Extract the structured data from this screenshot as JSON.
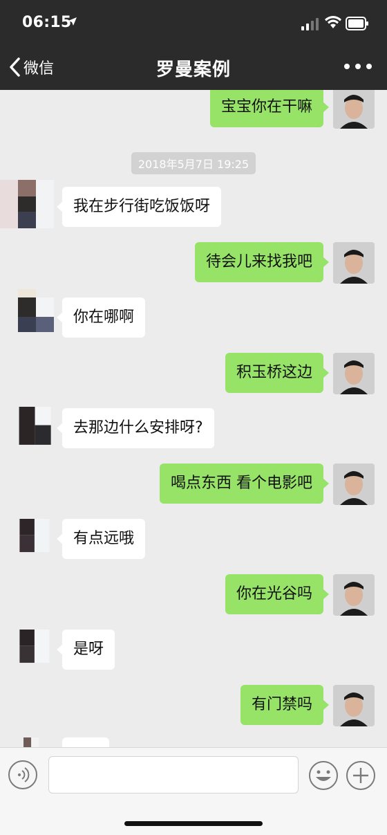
{
  "status_bar": {
    "time": "06:15"
  },
  "nav": {
    "back_label": "微信",
    "title": "罗曼案例"
  },
  "chat": {
    "timestamp": "2018年5月7日 19:25",
    "messages": [
      {
        "side": "out",
        "text": "宝宝你在干嘛"
      },
      {
        "side": "in",
        "text": "我在步行街吃饭饭呀"
      },
      {
        "side": "out",
        "text": "待会儿来找我吧"
      },
      {
        "side": "in",
        "text": "你在哪啊"
      },
      {
        "side": "out",
        "text": "积玉桥这边"
      },
      {
        "side": "in",
        "text": "去那边什么安排呀?"
      },
      {
        "side": "out",
        "text": "喝点东西 看个电影吧"
      },
      {
        "side": "in",
        "text": "有点远哦"
      },
      {
        "side": "out",
        "text": "你在光谷吗"
      },
      {
        "side": "in",
        "text": "是呀"
      },
      {
        "side": "out",
        "text": "有门禁吗"
      }
    ]
  },
  "input_bar": {
    "value": "",
    "icons": [
      "voice-icon",
      "emoji-icon",
      "plus-icon"
    ]
  },
  "colors": {
    "header_bg": "#2b2b2b",
    "chat_bg": "#ececec",
    "outgoing_bubble": "#97e368",
    "incoming_bubble": "#ffffff"
  }
}
